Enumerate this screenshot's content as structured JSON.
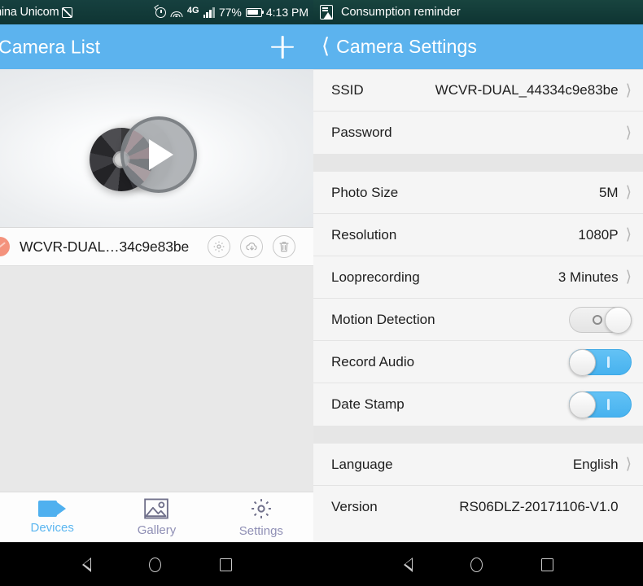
{
  "left": {
    "statusbar": {
      "carrier": "hina Unicom",
      "sim_icon": "sim-card-icon",
      "alarm_icon": "alarm-clock-icon",
      "wifi_icon": "wifi-icon",
      "network_type": "4G",
      "signal_icon": "signal-bars-icon",
      "battery_percent": "77%",
      "battery_icon": "battery-icon",
      "time": "4:13 PM"
    },
    "appbar": {
      "title": "Camera List",
      "add_icon": "plus-icon"
    },
    "thumbnail": {
      "play_icon": "play-icon",
      "reel_icon": "film-reel-icon"
    },
    "camera": {
      "name": "WCVR-DUAL…34c9e83be",
      "status_icon": "status-dot-icon",
      "actions": [
        {
          "name": "settings-icon"
        },
        {
          "name": "cloud-download-icon"
        },
        {
          "name": "delete-icon"
        }
      ]
    },
    "tabs": [
      {
        "label": "Devices",
        "icon": "camcorder-icon",
        "active": true
      },
      {
        "label": "Gallery",
        "icon": "image-icon",
        "active": false
      },
      {
        "label": "Settings",
        "icon": "gear-icon",
        "active": false
      }
    ],
    "navbar": {
      "back": "back-icon",
      "home": "home-icon",
      "recents": "recents-icon"
    }
  },
  "right": {
    "statusbar": {
      "icon": "report-icon",
      "text": "Consumption reminder"
    },
    "appbar": {
      "back_icon": "chevron-left-icon",
      "title": "Camera Settings"
    },
    "groups": [
      {
        "rows": [
          {
            "label": "SSID",
            "value": "WCVR-DUAL_44334c9e83be",
            "type": "link"
          },
          {
            "label": "Password",
            "value": "",
            "type": "link"
          }
        ]
      },
      {
        "rows": [
          {
            "label": "Photo Size",
            "value": "5M",
            "type": "link"
          },
          {
            "label": "Resolution",
            "value": "1080P",
            "type": "link"
          },
          {
            "label": "Looprecording",
            "value": "3 Minutes",
            "type": "link"
          },
          {
            "label": "Motion Detection",
            "value": "",
            "type": "toggle",
            "on": false
          },
          {
            "label": "Record Audio",
            "value": "",
            "type": "toggle",
            "on": true
          },
          {
            "label": "Date Stamp",
            "value": "",
            "type": "toggle",
            "on": true
          }
        ]
      },
      {
        "rows": [
          {
            "label": "Language",
            "value": "English",
            "type": "link"
          },
          {
            "label": "Version",
            "value": "RS06DLZ-20171106-V1.0",
            "type": "text"
          }
        ]
      }
    ],
    "navbar": {
      "back": "back-icon",
      "home": "home-icon",
      "recents": "recents-icon"
    }
  },
  "colors": {
    "appbar_blue": "#5cb3ee",
    "statusbar_dark": "#16403f",
    "toggle_on": "#47b2ef",
    "accent_tab": "#5bb6f0",
    "status_dot": "#f4927c"
  }
}
